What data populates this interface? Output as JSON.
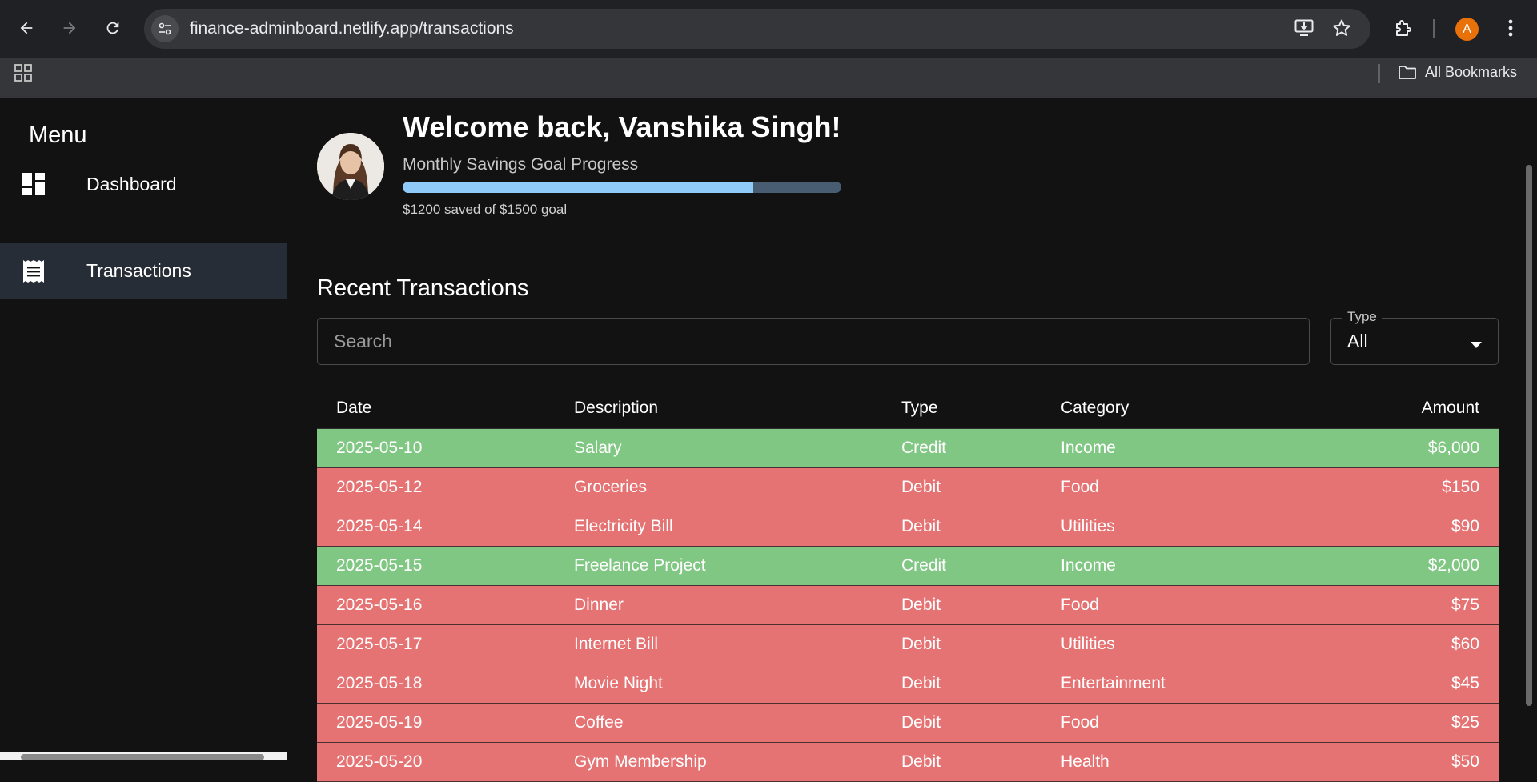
{
  "browser": {
    "url": "finance-adminboard.netlify.app/transactions",
    "profile_initial": "A",
    "all_bookmarks_label": "All Bookmarks"
  },
  "sidebar": {
    "title": "Menu",
    "items": [
      {
        "label": "Dashboard",
        "icon": "dashboard-icon",
        "active": false
      },
      {
        "label": "Transactions",
        "icon": "receipt-icon",
        "active": true
      }
    ]
  },
  "header": {
    "welcome": "Welcome back, Vanshika Singh!",
    "goal_label": "Monthly Savings Goal Progress",
    "goal_text": "$1200 saved of $1500 goal",
    "progress_fraction": 0.8
  },
  "transactions": {
    "title": "Recent Transactions",
    "search_placeholder": "Search",
    "type_filter": {
      "label": "Type",
      "value": "All"
    },
    "columns": [
      "Date",
      "Description",
      "Type",
      "Category",
      "Amount"
    ],
    "rows": [
      {
        "date": "2025-05-10",
        "description": "Salary",
        "type": "Credit",
        "category": "Income",
        "amount": "$6,000"
      },
      {
        "date": "2025-05-12",
        "description": "Groceries",
        "type": "Debit",
        "category": "Food",
        "amount": "$150"
      },
      {
        "date": "2025-05-14",
        "description": "Electricity Bill",
        "type": "Debit",
        "category": "Utilities",
        "amount": "$90"
      },
      {
        "date": "2025-05-15",
        "description": "Freelance Project",
        "type": "Credit",
        "category": "Income",
        "amount": "$2,000"
      },
      {
        "date": "2025-05-16",
        "description": "Dinner",
        "type": "Debit",
        "category": "Food",
        "amount": "$75"
      },
      {
        "date": "2025-05-17",
        "description": "Internet Bill",
        "type": "Debit",
        "category": "Utilities",
        "amount": "$60"
      },
      {
        "date": "2025-05-18",
        "description": "Movie Night",
        "type": "Debit",
        "category": "Entertainment",
        "amount": "$45"
      },
      {
        "date": "2025-05-19",
        "description": "Coffee",
        "type": "Debit",
        "category": "Food",
        "amount": "$25"
      },
      {
        "date": "2025-05-20",
        "description": "Gym Membership",
        "type": "Debit",
        "category": "Health",
        "amount": "$50"
      }
    ]
  },
  "colors": {
    "credit_row": "#81c784",
    "debit_row": "#e57373",
    "progress_fill": "#90caf9",
    "active_nav": "#272d36"
  }
}
